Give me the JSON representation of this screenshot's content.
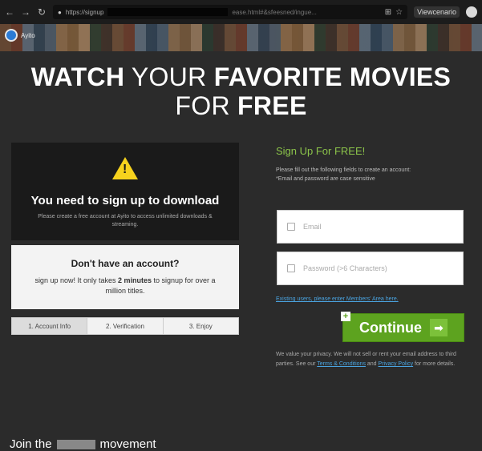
{
  "browser": {
    "url": "https://signup",
    "url_tail": "ease.html#&sfeesned/ingue...",
    "profile": "Viewcenario"
  },
  "site": {
    "brand": "Ayito"
  },
  "headline": {
    "line1_bold": "WATCH",
    "line1_regular": " YOUR ",
    "line1_bold2": "FAVORITE MOVIES",
    "line2_regular": "FOR ",
    "line2_bold": "FREE"
  },
  "download": {
    "title": "You need to sign up to download",
    "subtitle": "Please create a free account at Ayito to access unlimited downloads & streaming."
  },
  "account": {
    "title": "Don't have an account?",
    "sub_prefix": "sign up now! It only takes ",
    "sub_bold": "2 minutes",
    "sub_suffix": " to signup for over a million titles."
  },
  "steps": [
    "1. Account Info",
    "2. Verification",
    "3. Enjoy"
  ],
  "join": {
    "prefix": "Join the",
    "suffix": "movement"
  },
  "signup": {
    "title": "Sign Up For FREE!",
    "desc1": "Please fill out the following fields to create an account:",
    "desc2": "*Email and password are case sensitive",
    "email_placeholder": "Email",
    "password_placeholder": "Password (>6 Characters)",
    "members_link": "Existing users, please enter Members' Area here.",
    "continue_label": "Continue",
    "privacy_prefix": "We value your privacy. We will not sell or rent your email address to third parties. See our ",
    "terms_link": "Terms & Conditions",
    "privacy_mid": " and ",
    "policy_link": "Privacy Policy",
    "privacy_suffix": " for more details."
  }
}
